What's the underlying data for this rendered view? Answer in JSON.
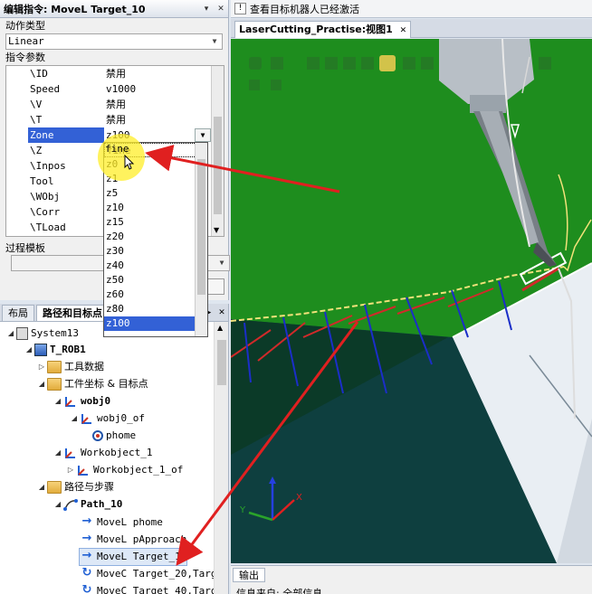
{
  "edit_panel": {
    "title": "编辑指令: MoveL Target_10",
    "pin": "▾",
    "close": "✕",
    "motion_type_label": "动作类型",
    "motion_type_value": "Linear",
    "params_label": "指令参数",
    "params": [
      {
        "key": "\\ID",
        "value": "禁用"
      },
      {
        "key": "Speed",
        "value": "v1000"
      },
      {
        "key": "\\V",
        "value": "禁用"
      },
      {
        "key": "\\T",
        "value": "禁用"
      },
      {
        "key": "Zone",
        "value": "z100"
      },
      {
        "key": "\\Z",
        "value": ""
      },
      {
        "key": "\\Inpos",
        "value": ""
      },
      {
        "key": "Tool",
        "value": ""
      },
      {
        "key": "\\WObj",
        "value": ""
      },
      {
        "key": "\\Corr",
        "value": ""
      },
      {
        "key": "\\TLoad",
        "value": ""
      }
    ],
    "process_template_label": "过程模板"
  },
  "zone_dropdown": {
    "items": [
      "fine",
      "z0",
      "z1",
      "z5",
      "z10",
      "z15",
      "z20",
      "z30",
      "z40",
      "z50",
      "z60",
      "z80",
      "z100"
    ]
  },
  "tree_panel": {
    "tabs": [
      "布局",
      "路径和目标点"
    ],
    "ctl_left": "◂",
    "ctl_right": "▸",
    "ctl_close": "✕",
    "nodes": {
      "system": "System13",
      "rob": "T_ROB1",
      "tooldata": "工具数据",
      "wobj_targets": "工件坐标 & 目标点",
      "wobj0": "wobj0",
      "wobj0_of": "wobj0_of",
      "phome": "phome",
      "workobject1": "Workobject_1",
      "workobject1_of": "Workobject_1_of",
      "paths": "路径与步骤",
      "path10": "Path_10",
      "instr": [
        "MoveL phome",
        "MoveL pApproach",
        "MoveL Target_10",
        "MoveC Target_20,Targ",
        "MoveC Target_40,Targ"
      ]
    }
  },
  "status_bar": {
    "text": "查看目标机器人已经激活"
  },
  "view": {
    "tab_label": "LaserCutting_Practise:视图1",
    "tab_close": "✕",
    "axis_x": "X",
    "axis_y": "Y"
  },
  "output": {
    "tab_label": "输出",
    "line": "信息来自: 全部信息"
  },
  "colors": {
    "viewport_green": "#1e8d1e",
    "selection_blue": "#3361d6",
    "arrow_red": "#e02020"
  }
}
